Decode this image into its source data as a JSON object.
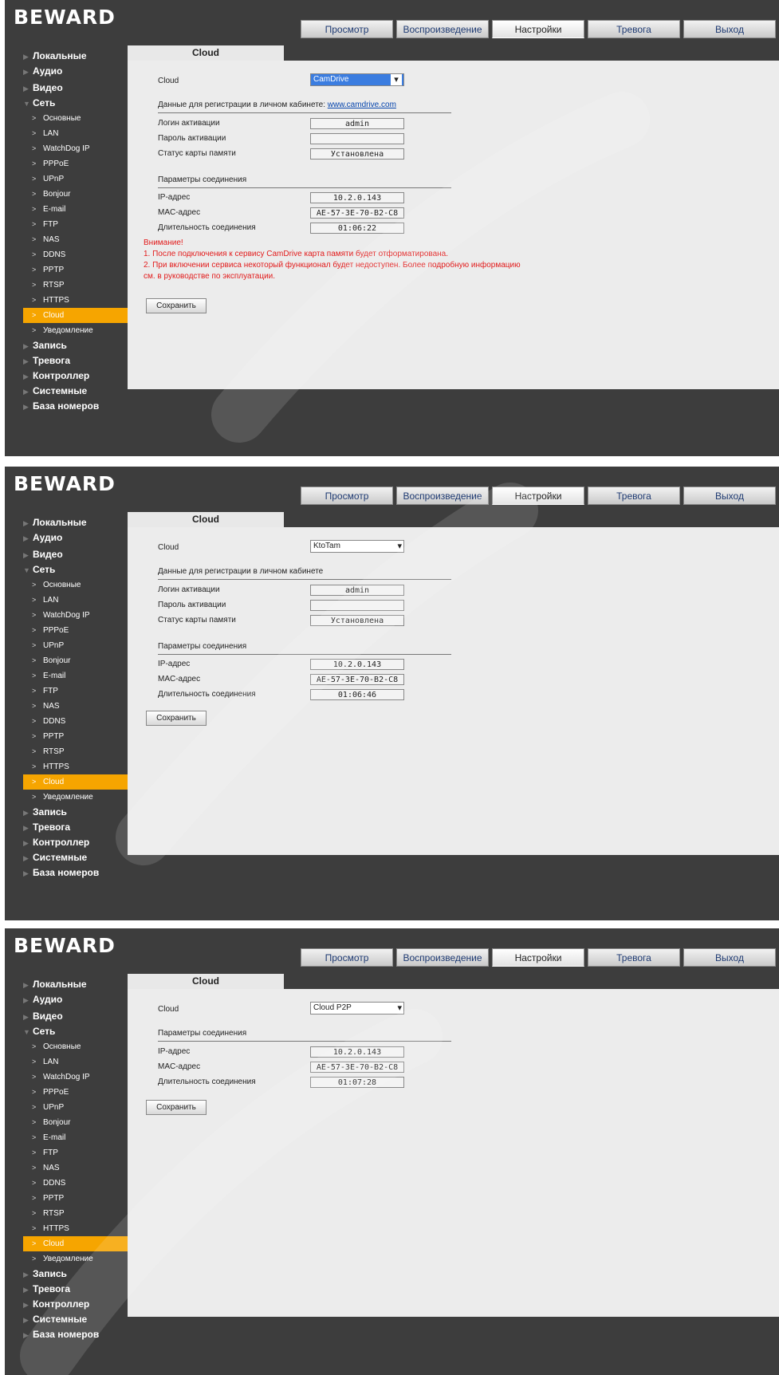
{
  "brand": "BEWARD",
  "tabs": [
    "Просмотр",
    "Воспроизведение",
    "Настройки",
    "Тревога",
    "Выход"
  ],
  "sidebar": {
    "top": [
      "Локальные",
      "Аудио",
      "Видео",
      "Сеть"
    ],
    "sub": [
      "Основные",
      "LAN",
      "WatchDog IP",
      "PPPoE",
      "UPnP",
      "Bonjour",
      "E-mail",
      "FTP",
      "NAS",
      "DDNS",
      "PPTP",
      "RTSP",
      "HTTPS",
      "Cloud",
      "Уведомление"
    ],
    "bottom": [
      "Запись",
      "Тревога",
      "Контроллер",
      "Системные",
      "База номеров"
    ]
  },
  "content_tab": "Cloud",
  "labels": {
    "cloud": "Cloud",
    "reg_section_1": "Данные для регистрации в личном кабинете: ",
    "reg_link": "www.camdrive.com",
    "reg_section_2": "Данные для регистрации в личном кабинете",
    "login": "Логин активации",
    "password": "Пароль активации",
    "card_status": "Статус карты памяти",
    "conn_section": "Параметры соединения",
    "ip": "IP-адрес",
    "mac": "MAC-адрес",
    "duration": "Длительность соединения",
    "save": "Сохранить"
  },
  "screens": [
    {
      "cloud_value": "CamDrive",
      "login": "admin",
      "password": "",
      "card_status": "Установлена",
      "ip": "10.2.0.143",
      "mac": "AE-57-3E-70-B2-C8",
      "duration": "01:06:22",
      "warning_title": "Внимание!",
      "warning_1": "1. После подключения к сервису CamDrive карта памяти будет отформатирована.",
      "warning_2": "2. При включении сервиса некоторый функционал будет недоступен. Более подробную информацию см. в руководстве по эксплуатации."
    },
    {
      "cloud_value": "KtoTam",
      "login": "admin",
      "password": "",
      "card_status": "Установлена",
      "ip": "10.2.0.143",
      "mac": "AE-57-3E-70-B2-C8",
      "duration": "01:06:46"
    },
    {
      "cloud_value": "Cloud P2P",
      "ip": "10.2.0.143",
      "mac": "AE-57-3E-70-B2-C8",
      "duration": "01:07:28"
    }
  ],
  "colors": {
    "panel": "#3d3d3d",
    "accent": "#f6a500",
    "warning": "#e21b1b",
    "link": "#0645ad"
  }
}
